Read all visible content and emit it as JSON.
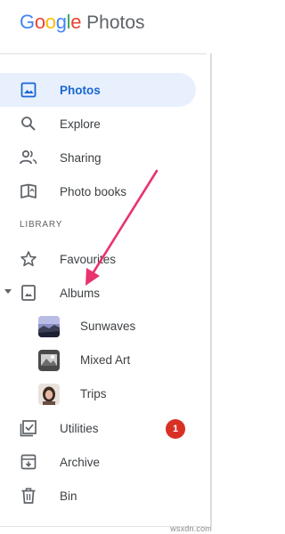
{
  "app": {
    "brand": "Google",
    "product": "Photos",
    "brand_colors": [
      "#4285f4",
      "#ea4335",
      "#fbbc05",
      "#4285f4",
      "#34a853",
      "#ea4335"
    ]
  },
  "nav": {
    "primary": [
      {
        "label": "Photos",
        "icon": "photos-icon",
        "active": true
      },
      {
        "label": "Explore",
        "icon": "search-icon",
        "active": false
      },
      {
        "label": "Sharing",
        "icon": "people-icon",
        "active": false
      },
      {
        "label": "Photo books",
        "icon": "book-icon",
        "active": false
      }
    ],
    "section_label": "LIBRARY",
    "library": [
      {
        "label": "Favourites",
        "icon": "star-icon"
      },
      {
        "label": "Albums",
        "icon": "album-icon",
        "expanded": true
      },
      {
        "label": "Sunwaves",
        "icon": "album-thumbnail"
      },
      {
        "label": "Mixed Art",
        "icon": "album-thumbnail"
      },
      {
        "label": "Trips",
        "icon": "album-thumbnail"
      },
      {
        "label": "Utilities",
        "icon": "utilities-icon",
        "badge": "1"
      },
      {
        "label": "Archive",
        "icon": "archive-icon"
      },
      {
        "label": "Bin",
        "icon": "trash-icon"
      }
    ]
  },
  "watermark": "wsxdn.com",
  "colors": {
    "active_bg": "#e8f0fe",
    "active_text": "#1967d2",
    "badge": "#d93025",
    "arrow": "#e8336e"
  }
}
